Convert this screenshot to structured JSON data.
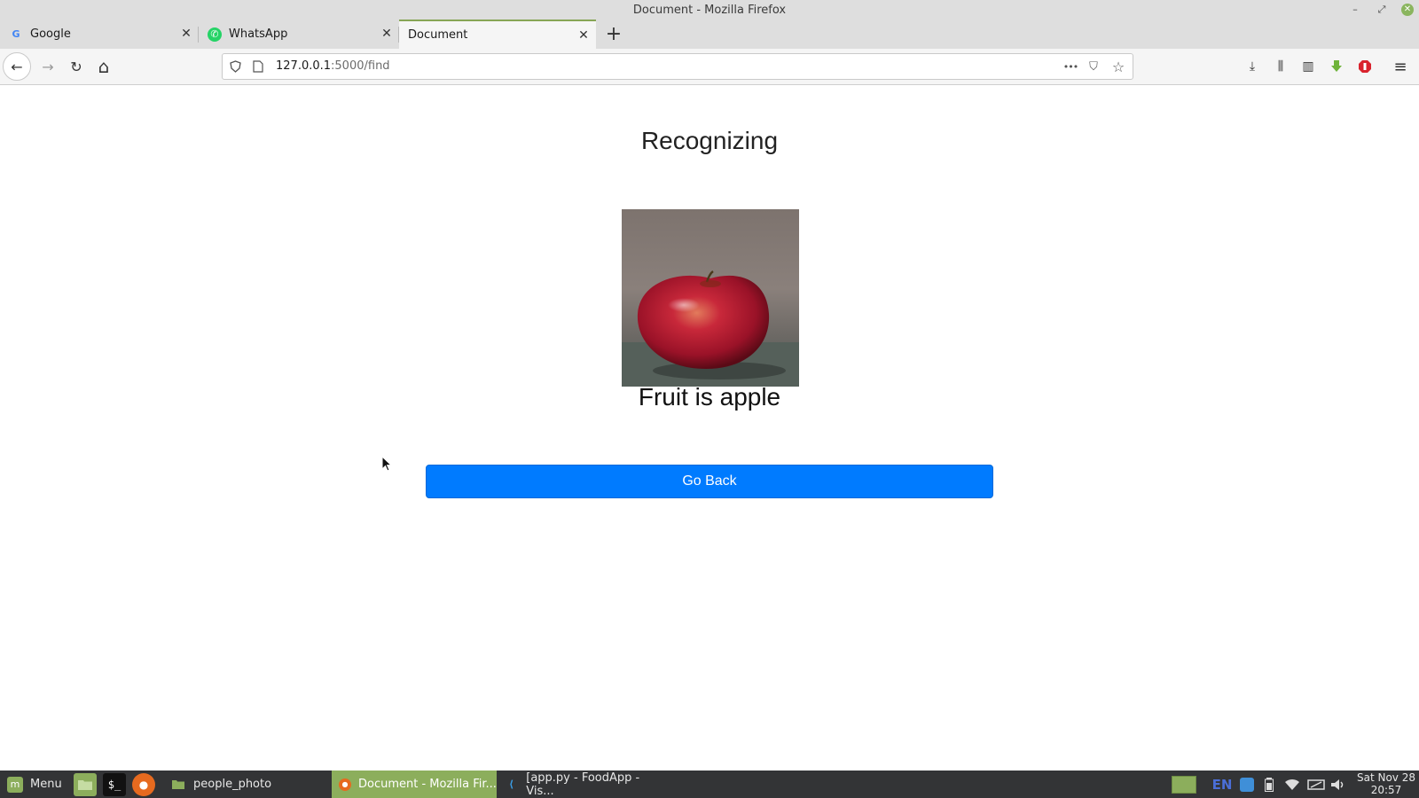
{
  "window": {
    "title": "Document - Mozilla Firefox",
    "minimize_glyph": "–",
    "maximize_glyph": "⤢",
    "close_glyph": "✕"
  },
  "tabs": [
    {
      "label": "Google",
      "icon": "google-icon",
      "icon_glyph": "G"
    },
    {
      "label": "WhatsApp",
      "icon": "whatsapp-icon",
      "icon_glyph": "✆"
    },
    {
      "label": "Document",
      "icon": "",
      "icon_glyph": ""
    }
  ],
  "tab_close_glyph": "✕",
  "new_tab_glyph": "+",
  "nav": {
    "back_glyph": "←",
    "forward_glyph": "→",
    "reload_glyph": "↻",
    "home_glyph": "⌂",
    "url_host": "127.0.0.1",
    "url_path": ":5000/find",
    "page_actions_glyph": "•••",
    "pocket_glyph": "⛉",
    "bookmark_glyph": "☆",
    "download_glyph": "⤓",
    "library_glyph": "⫼",
    "sidebar_glyph": "▥",
    "menu_glyph": "≡"
  },
  "page": {
    "title": "Recognizing",
    "result": "Fruit is apple",
    "go_back_label": "Go Back"
  },
  "taskbar": {
    "menu_label": "Menu",
    "items": [
      {
        "label": "people_photo"
      },
      {
        "label": "Document - Mozilla Fir..."
      },
      {
        "label": "[app.py - FoodApp - Vis..."
      }
    ],
    "lang": "EN",
    "clock_date": "Sat Nov 28",
    "clock_time": "20:57"
  },
  "colors": {
    "accent_button": "#007bff",
    "taskbar_active": "#8cae5c",
    "tab_active_border": "#87a556"
  }
}
